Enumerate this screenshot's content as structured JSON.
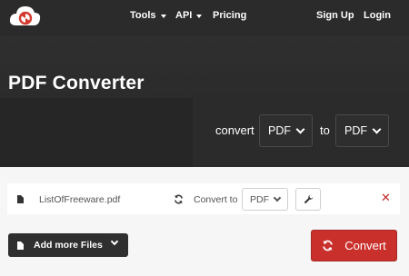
{
  "nav": {
    "tools": "Tools",
    "api": "API",
    "pricing": "Pricing",
    "signup": "Sign Up",
    "login": "Login"
  },
  "hero": {
    "title": "PDF Converter",
    "convert_label": "convert",
    "from_format": "PDF",
    "to_label": "to",
    "to_format": "PDF"
  },
  "file": {
    "name": "ListOfFreeware.pdf",
    "convert_to_label": "Convert to",
    "target_format": "PDF"
  },
  "actions": {
    "add_files": "Add more Files",
    "convert": "Convert"
  },
  "colors": {
    "accent": "#c9302c",
    "hero_bg": "#2b2b2b"
  }
}
